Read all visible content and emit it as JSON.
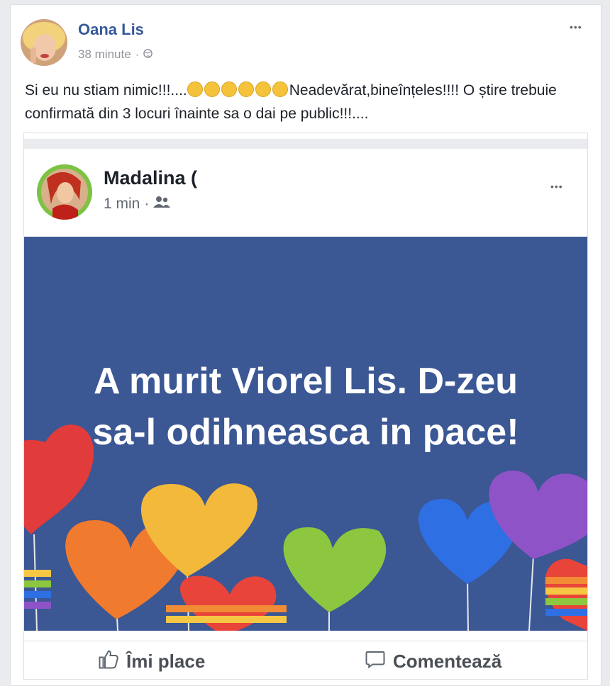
{
  "post": {
    "author": "Oana Lis",
    "time": "38 minute",
    "separator": "·",
    "text_before_emojis": "Si eu nu stiam nimic!!!....",
    "text_after_emojis": "Neadevărat,bineînțeles!!!! O știre trebuie confirmată din 3 locuri înainte sa o dai pe public!!!....",
    "emoji_icons": [
      "anxious-face-icon",
      "tears-of-joy-icon",
      "winking-tongue-icon",
      "smiling-face-icon",
      "rolling-eyes-icon",
      "rolling-eyes-icon"
    ],
    "more_label": "•••"
  },
  "shared": {
    "author": "Madalina (",
    "time": "1 min",
    "separator": "·",
    "audience_icon": "friends-icon",
    "more_label": "•••",
    "banner_text": "A murit Viorel Lis. D-zeu sa-l odihneasca in pace!",
    "banner_color": "#3b5794"
  },
  "actions": {
    "like_label": "Îmi place",
    "comment_label": "Comentează"
  }
}
